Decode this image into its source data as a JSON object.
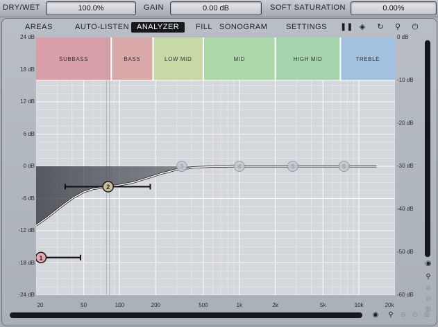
{
  "toolbar": {
    "dry_wet_label": "DRY/WET",
    "dry_wet_value": "100.0%",
    "gain_label": "GAIN",
    "gain_value": "0.00 dB",
    "soft_saturation_label": "SOFT SATURATION",
    "soft_saturation_value": "0.00%"
  },
  "menu": {
    "areas": "AREAS",
    "auto_listen": "AUTO-LISTEN",
    "analyzer": "ANALYZER",
    "fill": "FILL",
    "sonogram": "SONOGRAM",
    "settings": "SETTINGS"
  },
  "icons": {
    "pause": "pause-icon",
    "speaker": "speaker-icon",
    "reset": "reset-icon",
    "zoom": "zoom-icon",
    "power": "power-icon"
  },
  "bands": [
    {
      "label": "SUBBASS",
      "color": "#d99aa3",
      "from": 20,
      "to": 85
    },
    {
      "label": "BASS",
      "color": "#d9a5a5",
      "from": 85,
      "to": 190
    },
    {
      "label": "LOW MID",
      "color": "#c6d9a0",
      "from": 190,
      "to": 500
    },
    {
      "label": "MID",
      "color": "#a9d8a5",
      "from": 500,
      "to": 2000
    },
    {
      "label": "HIGH MID",
      "color": "#9fd5a8",
      "from": 2000,
      "to": 7000
    },
    {
      "label": "TREBLE",
      "color": "#9dbfe0",
      "from": 7000,
      "to": 20000
    }
  ],
  "axis": {
    "left_labels": [
      "24 dB",
      "18 dB",
      "12 dB",
      "6 dB",
      "0 dB",
      "-6 dB",
      "-12 dB",
      "-18 dB",
      "-24 dB"
    ],
    "right_labels": [
      "0 dB",
      "-10 dB",
      "-20 dB",
      "-30 dB",
      "-40 dB",
      "-50 dB",
      "-60 dB"
    ],
    "bottom_labels": [
      "20",
      "50",
      "100",
      "200",
      "500",
      "1k",
      "2k",
      "5k",
      "10k",
      "20k"
    ]
  },
  "nodes": [
    {
      "id": "1",
      "freq": 20,
      "gain": -17,
      "color": "#e6a9ae",
      "active": true,
      "width_from": 20,
      "width_to": 47
    },
    {
      "id": "2",
      "freq": 80,
      "gain": -3.8,
      "color": "#c9bf98",
      "active": true,
      "width_from": 35,
      "width_to": 180
    },
    {
      "id": "3",
      "freq": 330,
      "gain": 0,
      "color": "#c5c9cf",
      "active": false
    },
    {
      "id": "4",
      "freq": 1000,
      "gain": 0,
      "color": "#c5c9cf",
      "active": false
    },
    {
      "id": "5",
      "freq": 2800,
      "gain": 0,
      "color": "#c5c9cf",
      "active": false
    },
    {
      "id": "6",
      "freq": 7500,
      "gain": 0,
      "color": "#c5c9cf",
      "active": false
    }
  ],
  "curve": [
    [
      20,
      -11
    ],
    [
      25,
      -9.5
    ],
    [
      32,
      -7.6
    ],
    [
      40,
      -6
    ],
    [
      50,
      -4.8
    ],
    [
      60,
      -4.2
    ],
    [
      80,
      -3.8
    ],
    [
      100,
      -3.5
    ],
    [
      130,
      -3.0
    ],
    [
      170,
      -2.2
    ],
    [
      220,
      -1.4
    ],
    [
      300,
      -0.6
    ],
    [
      420,
      -0.2
    ],
    [
      600,
      -0.05
    ],
    [
      1000,
      0
    ],
    [
      5000,
      0
    ],
    [
      14000,
      0
    ]
  ]
}
